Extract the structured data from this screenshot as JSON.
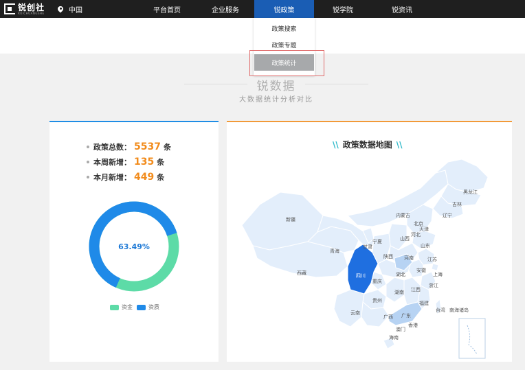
{
  "nav": {
    "logo_text": "锐创社",
    "logo_sub": "RUICHUANGSHE",
    "location": "中国",
    "items": [
      "平台首页",
      "企业服务",
      "锐政策",
      "锐学院",
      "锐资讯"
    ]
  },
  "dropdown": {
    "items": [
      "政策搜索",
      "政策专题",
      "政策统计"
    ]
  },
  "section": {
    "title": "锐数据",
    "subtitle": "大数据统计分析对比"
  },
  "stats": [
    {
      "label": "政策总数：",
      "value": "5537",
      "unit": "条"
    },
    {
      "label": "本周新增：",
      "value": "135",
      "unit": "条"
    },
    {
      "label": "本月新增：",
      "value": "449",
      "unit": "条"
    }
  ],
  "donut": {
    "center_label": "63.49%",
    "fraction": 0.6349,
    "legend": [
      {
        "label": "资金",
        "color": "#5ddba7"
      },
      {
        "label": "资质",
        "color": "#1f8ae8"
      }
    ]
  },
  "map": {
    "title": "政策数据地图",
    "highlight_color": "#1f6fe0",
    "base_color": "#e3eefb",
    "provinces": [
      "黑龙江",
      "吉林",
      "辽宁",
      "内蒙古",
      "北京",
      "天津",
      "河北",
      "新疆",
      "宁夏",
      "山西",
      "山东",
      "青海",
      "甘肃",
      "陕西",
      "河南",
      "江苏",
      "西藏",
      "四川",
      "湖北",
      "安徽",
      "上海",
      "重庆",
      "浙江",
      "湖南",
      "江西",
      "贵州",
      "福建",
      "云南",
      "广西",
      "广东",
      "台湾",
      "香港",
      "澳门",
      "海南",
      "南海诸岛"
    ]
  },
  "colors": {
    "nav_bg": "#1f1f1f",
    "nav_active": "#1a5db4",
    "accent_blue": "#1f8de5",
    "accent_orange": "#f29a38",
    "number_orange": "#f28b1b"
  }
}
